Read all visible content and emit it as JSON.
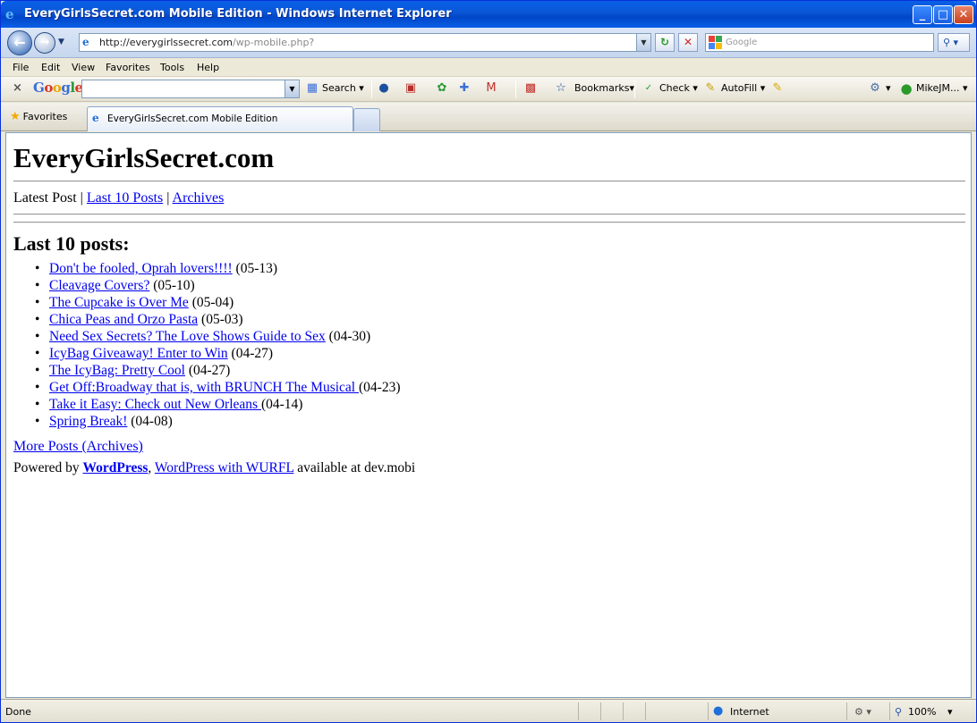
{
  "window": {
    "title": "EveryGirlsSecret.com Mobile Edition - Windows Internet Explorer",
    "buttons": {
      "minimize": "_",
      "maximize": "□",
      "close": "✕"
    }
  },
  "address_bar": {
    "url_host": "http://everygirlssecret.com",
    "url_path": "/wp-mobile.php?",
    "search_placeholder": "Google"
  },
  "menu": [
    "File",
    "Edit",
    "View",
    "Favorites",
    "Tools",
    "Help"
  ],
  "google_toolbar": {
    "close": "×",
    "logo": "Google",
    "search_label": "Search",
    "bookmarks_label": "Bookmarks",
    "check_label": "Check",
    "autofill_label": "AutoFill",
    "user_label": "MikeJM..."
  },
  "tabs": {
    "favorites_label": "Favorites",
    "active_tab_label": "EveryGirlsSecret.com Mobile Edition"
  },
  "page": {
    "site_title": "EveryGirlsSecret.com",
    "nav": {
      "latest": "Latest Post",
      "sep1": " | ",
      "last10": "Last 10 Posts",
      "sep2": " | ",
      "archives": "Archives"
    },
    "section_title": "Last 10 posts:",
    "posts": [
      {
        "title": "Don't be fooled, Oprah lovers!!!!",
        "date": " (05-13)"
      },
      {
        "title": "Cleavage Covers?",
        "date": " (05-10)"
      },
      {
        "title": "The Cupcake is Over Me",
        "date": " (05-04)"
      },
      {
        "title": "Chica Peas and Orzo Pasta",
        "date": " (05-03)"
      },
      {
        "title": "Need Sex Secrets? The Love Shows Guide to Sex",
        "date": " (04-30)"
      },
      {
        "title": "IcyBag Giveaway! Enter to Win",
        "date": " (04-27)"
      },
      {
        "title": "The IcyBag: Pretty Cool",
        "date": " (04-27)"
      },
      {
        "title": "Get Off:Broadway that is, with BRUNCH The Musical ",
        "date": "(04-23)"
      },
      {
        "title": "Take it Easy: Check out New Orleans ",
        "date": "(04-14)"
      },
      {
        "title": "Spring Break!",
        "date": " (04-08)"
      }
    ],
    "more_posts": "More Posts (Archives)",
    "powered": {
      "prefix": "Powered by ",
      "wordpress": "WordPress",
      "comma": ", ",
      "wurfl": "WordPress with WURFL",
      "suffix": " available at dev.mobi"
    }
  },
  "status": {
    "text": "Done",
    "zone": "Internet",
    "zoom": "100%"
  }
}
